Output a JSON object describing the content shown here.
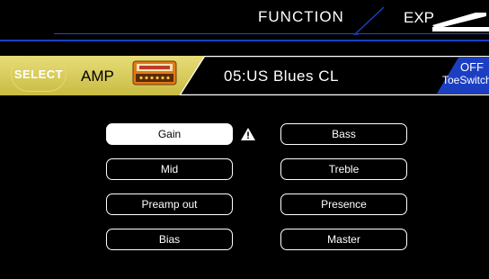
{
  "header": {
    "function_label": "FUNCTION",
    "exp_label": "EXP"
  },
  "amp_strip": {
    "select_label": "SELECT",
    "amp_label": "AMP",
    "amp_icon": "amp-head-icon",
    "preset_name": "05:US Blues CL",
    "toeswitch_state": "OFF",
    "toeswitch_label": "ToeSwitch"
  },
  "params": {
    "left": [
      "Gain",
      "Mid",
      "Preamp out",
      "Bias"
    ],
    "right": [
      "Bass",
      "Treble",
      "Presence",
      "Master"
    ],
    "active": "Gain"
  },
  "colors": {
    "accent_blue": "#1c3fc2",
    "strip_yellow": "#cfc24a",
    "strip_yellow_light": "#e7dc79",
    "background": "#000000"
  }
}
